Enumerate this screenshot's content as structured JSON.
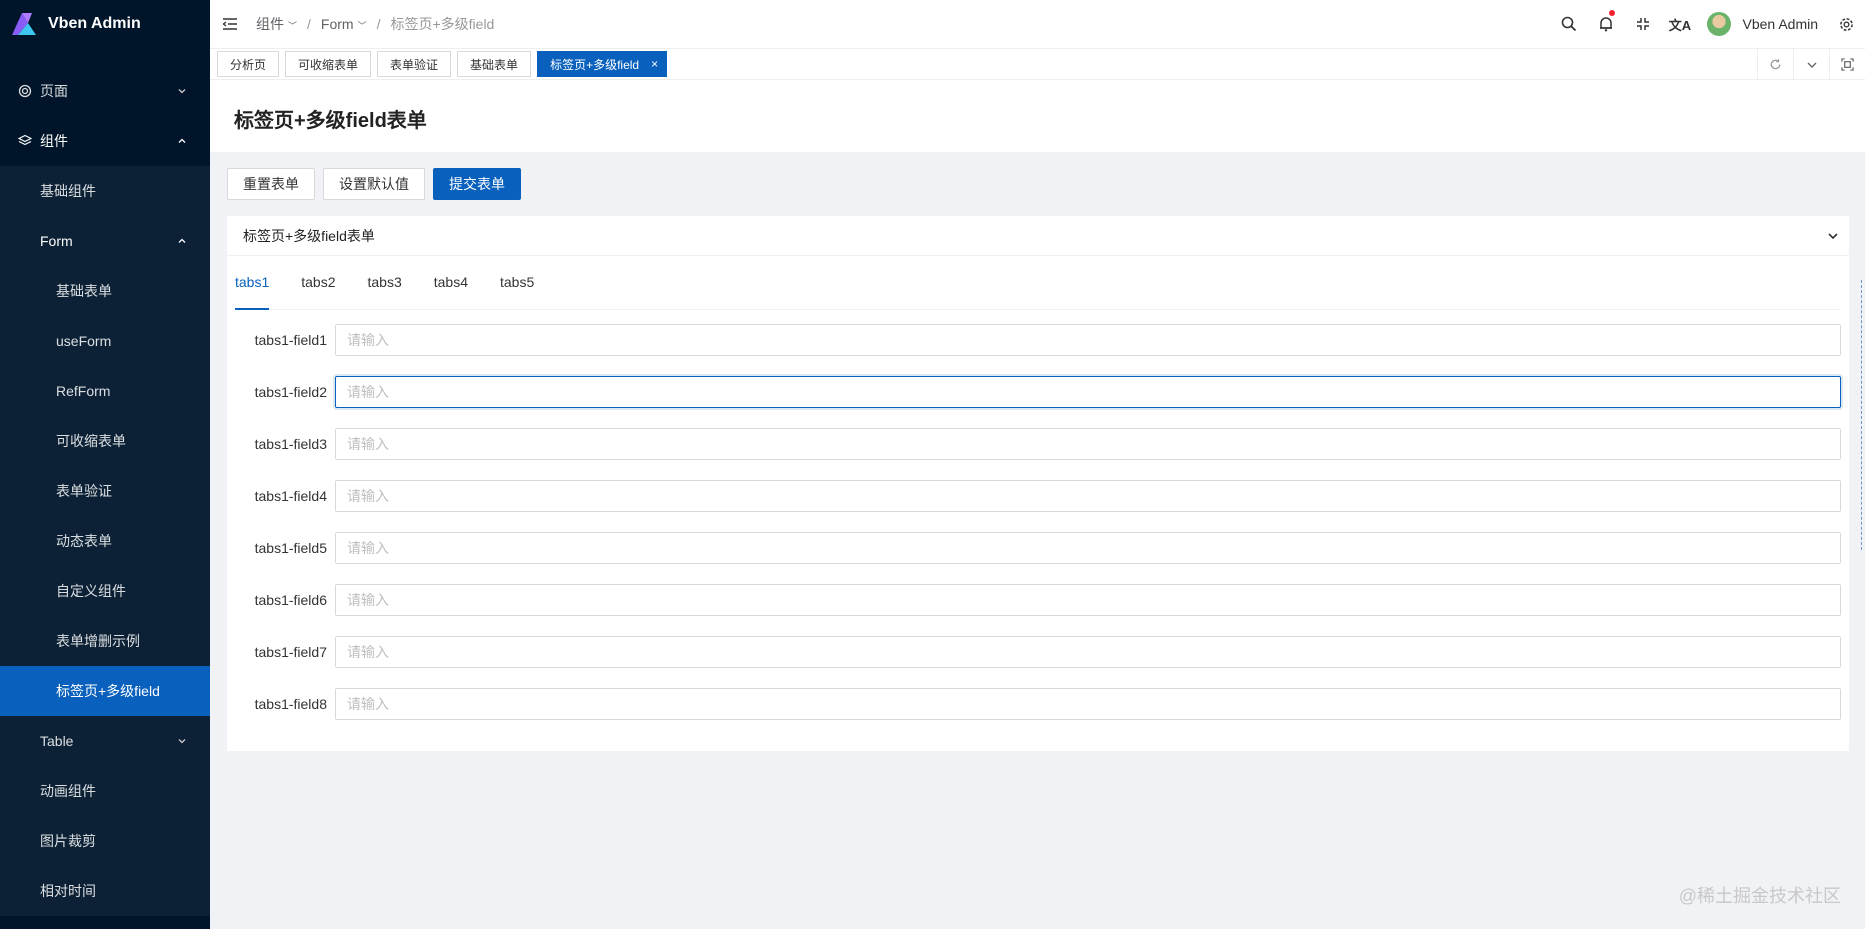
{
  "app": {
    "title": "Vben Admin"
  },
  "sidebar": {
    "items": [
      {
        "label": "页面"
      },
      {
        "label": "组件"
      },
      {
        "label": "基础组件"
      },
      {
        "label": "Form"
      },
      {
        "label": "基础表单"
      },
      {
        "label": "useForm"
      },
      {
        "label": "RefForm"
      },
      {
        "label": "可收缩表单"
      },
      {
        "label": "表单验证"
      },
      {
        "label": "动态表单"
      },
      {
        "label": "自定义组件"
      },
      {
        "label": "表单增删示例"
      },
      {
        "label": "标签页+多级field"
      },
      {
        "label": "Table"
      },
      {
        "label": "动画组件"
      },
      {
        "label": "图片裁剪"
      },
      {
        "label": "相对时间"
      }
    ]
  },
  "header": {
    "breadcrumb": [
      "组件",
      "Form",
      "标签页+多级field"
    ],
    "user": "Vben Admin"
  },
  "page_tabs": [
    "分析页",
    "可收缩表单",
    "表单验证",
    "基础表单",
    "标签页+多级field"
  ],
  "page": {
    "title": "标签页+多级field表单"
  },
  "actions": {
    "reset": "重置表单",
    "set_default": "设置默认值",
    "submit": "提交表单"
  },
  "card": {
    "title": "标签页+多级field表单",
    "tabs": [
      "tabs1",
      "tabs2",
      "tabs3",
      "tabs4",
      "tabs5"
    ],
    "active_tab": "tabs1",
    "placeholder": "请输入",
    "fields": [
      "tabs1-field1",
      "tabs1-field2",
      "tabs1-field3",
      "tabs1-field4",
      "tabs1-field5",
      "tabs1-field6",
      "tabs1-field7",
      "tabs1-field8"
    ]
  },
  "watermark": "@稀土掘金技术社区",
  "colors": {
    "primary": "#0960bd",
    "sidebar": "#001529",
    "notification": "#f5222d"
  }
}
